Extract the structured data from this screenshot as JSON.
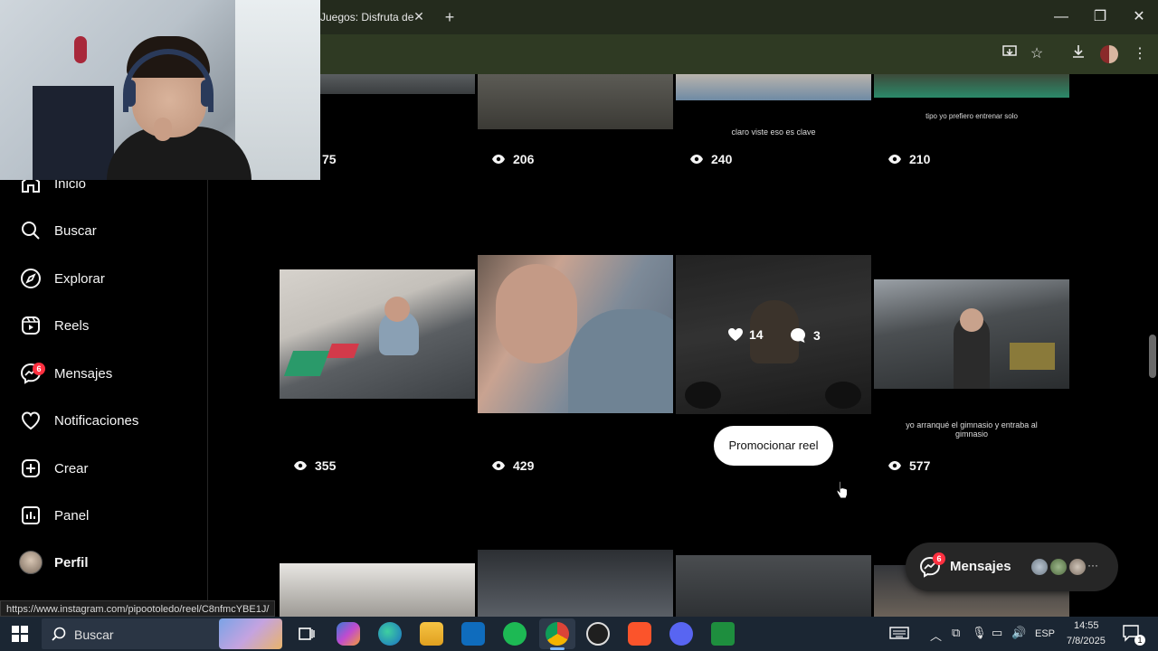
{
  "browser": {
    "tab_title": "Juegos: Disfruta de",
    "tab_close": "✕",
    "new_tab": "+",
    "minimize": "—",
    "restore": "❐",
    "close": "✕"
  },
  "sidebar": {
    "items": [
      {
        "label": "Inicio",
        "icon": "home-icon"
      },
      {
        "label": "Buscar",
        "icon": "search-icon"
      },
      {
        "label": "Explorar",
        "icon": "compass-icon"
      },
      {
        "label": "Reels",
        "icon": "reels-icon"
      },
      {
        "label": "Mensajes",
        "icon": "messenger-icon",
        "badge": "6"
      },
      {
        "label": "Notificaciones",
        "icon": "heart-icon"
      },
      {
        "label": "Crear",
        "icon": "plus-square-icon"
      },
      {
        "label": "Panel",
        "icon": "chart-icon"
      },
      {
        "label": "Perfil",
        "icon": "avatar"
      }
    ]
  },
  "grid": {
    "row1": [
      {
        "views": "75",
        "caption": ""
      },
      {
        "views": "206",
        "caption": ""
      },
      {
        "views": "240",
        "caption": "claro viste eso es clave"
      },
      {
        "views": "210",
        "caption": "tipo yo prefiero entrenar solo"
      }
    ],
    "row2": [
      {
        "views": "355",
        "caption": ""
      },
      {
        "views": "429",
        "caption": ""
      },
      {
        "views": "",
        "likes": "14",
        "comments": "3",
        "caption": ""
      },
      {
        "views": "577",
        "caption": "yo arranqué el gimnasio y entraba al gimnasio"
      }
    ],
    "promote_label": "Promocionar reel"
  },
  "messages_pill": {
    "label": "Mensajes",
    "badge": "6",
    "more": "···"
  },
  "status_url": "https://www.instagram.com/pipootoledo/reel/C8nfmcYBE1J/",
  "taskbar": {
    "search_placeholder": "Buscar",
    "lang": "ESP",
    "time": "14:55",
    "date": "7/8/2025",
    "notif_count": "1"
  },
  "colors": {
    "accent_red": "#ff3040",
    "chrome_dark": "#242b1d",
    "taskbar": "#1b2633"
  }
}
